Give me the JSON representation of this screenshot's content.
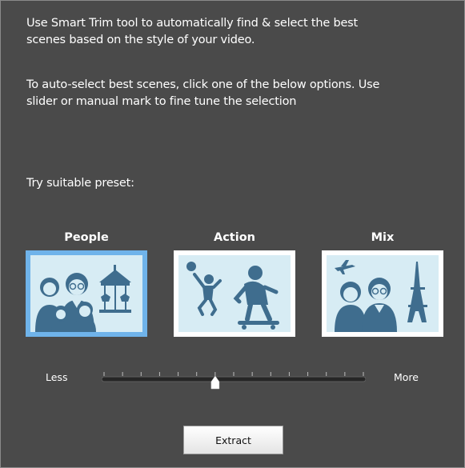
{
  "intro": {
    "line1": "Use Smart Trim tool to automatically find & select the best",
    "line2": "scenes based on the style of your video.",
    "line3": "To auto-select best scenes, click one of the below options. Use",
    "line4": "slider or manual mark to fine tune the selection"
  },
  "preset_heading": "Try suitable preset:",
  "presets": [
    {
      "label": "People",
      "selected": true
    },
    {
      "label": "Action",
      "selected": false
    },
    {
      "label": "Mix",
      "selected": false
    }
  ],
  "slider": {
    "min_label": "Less",
    "max_label": "More",
    "value": 0.43,
    "tick_count": 15
  },
  "extract_button": "Extract",
  "colors": {
    "panel_bg": "#4a4a4a",
    "selected_border": "#6fb3ea",
    "illustration": "#3f6d8e",
    "illustration_bg": "#d7ecf4"
  }
}
